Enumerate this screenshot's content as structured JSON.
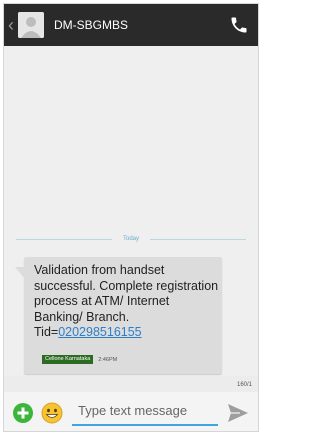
{
  "header": {
    "contact_name": "DM-SBGMBS",
    "back_icon": "chevron-left-icon",
    "avatar_icon": "contact-avatar-icon",
    "call_icon": "phone-icon"
  },
  "conversation": {
    "date_divider": "Today",
    "message": {
      "text": "Validation from handset successful. Complete registration process at ATM/ Internet Banking/ Branch. Tid=",
      "tid_link": "020298516155",
      "sim_badge": "Cellone Karnataka",
      "time": "2:46PM"
    }
  },
  "compose": {
    "char_counter": "160/1",
    "placeholder": "Type text message",
    "add_icon": "add-icon",
    "emoji_icon": "emoji-icon",
    "send_icon": "send-icon"
  },
  "colors": {
    "action_bar": "#2a2a2a",
    "background": "#efefef",
    "bubble": "#dcdcdc",
    "link": "#2c7fc9",
    "accent": "#3ea6dc",
    "add_green": "#3db53c",
    "emoji_yellow": "#f6c433",
    "sim_badge": "#2b6b22"
  }
}
